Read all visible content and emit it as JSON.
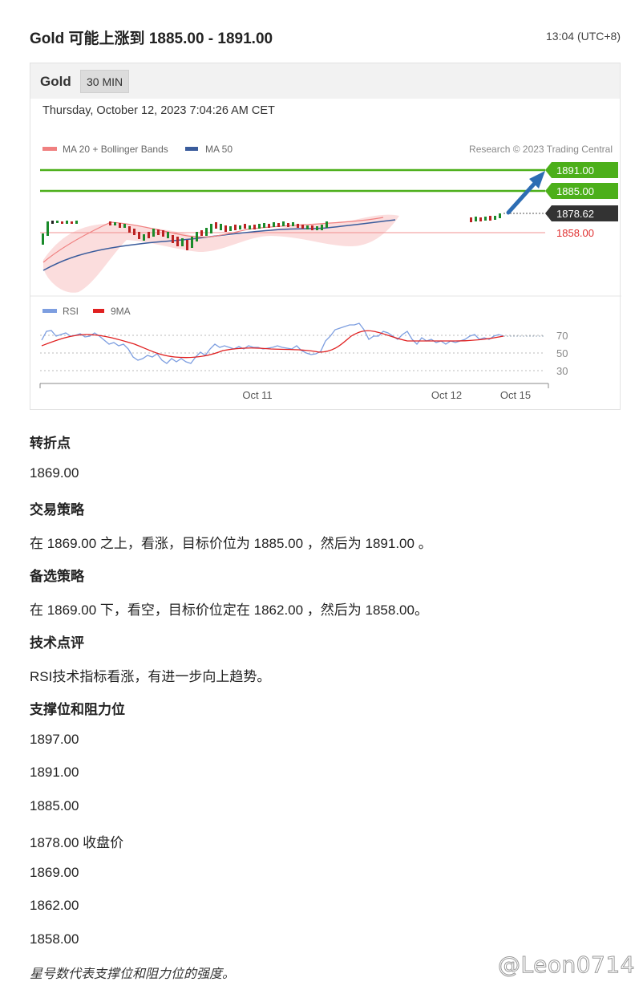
{
  "header": {
    "title": "Gold 可能上涨到 1885.00 - 1891.00",
    "time": "13:04 (UTC+8)"
  },
  "chart": {
    "symbol": "Gold",
    "timeframe": "30 MIN",
    "datetime": "Thursday, October 12, 2023 7:04:26 AM CET",
    "legend": [
      {
        "label": "MA 20 + Bollinger Bands",
        "color": "#f08080"
      },
      {
        "label": "MA 50",
        "color": "#3a5c9c"
      }
    ],
    "credit": "Research © 2023 Trading Central",
    "price_labels": [
      {
        "value": "1891.00",
        "kind": "target",
        "color": "#4caf1a"
      },
      {
        "value": "1885.00",
        "kind": "target",
        "color": "#4caf1a"
      },
      {
        "value": "1878.62",
        "kind": "current",
        "color": "#333333"
      },
      {
        "value": "1858.00",
        "kind": "support",
        "color": "#e03030"
      }
    ],
    "rsi_legend": [
      {
        "label": "RSI",
        "color": "#7d9ee0"
      },
      {
        "label": "9MA",
        "color": "#e02020"
      }
    ],
    "rsi_levels": [
      "70",
      "50",
      "30"
    ],
    "x_labels": [
      "Oct 11",
      "Oct 12",
      "Oct 15"
    ]
  },
  "sections": [
    {
      "title": "转折点",
      "lines": [
        "1869.00"
      ]
    },
    {
      "title": "交易策略",
      "lines": [
        "在 1869.00 之上，看涨，目标价位为 1885.00 ，然后为 1891.00 。"
      ]
    },
    {
      "title": "备选策略",
      "lines": [
        "在 1869.00 下，看空，目标价位定在 1862.00 ，然后为 1858.00。"
      ]
    },
    {
      "title": "技术点评",
      "lines": [
        "RSI技术指标看涨，有进一步向上趋势。"
      ]
    },
    {
      "title": "支撑位和阻力位",
      "lines": [
        "1897.00",
        "1891.00",
        "1885.00",
        "1878.00 收盘价",
        "1869.00",
        "1862.00",
        "1858.00"
      ]
    }
  ],
  "footnote": "星号数代表支撑位和阻力位的强度。",
  "watermark": "@Leon0714"
}
